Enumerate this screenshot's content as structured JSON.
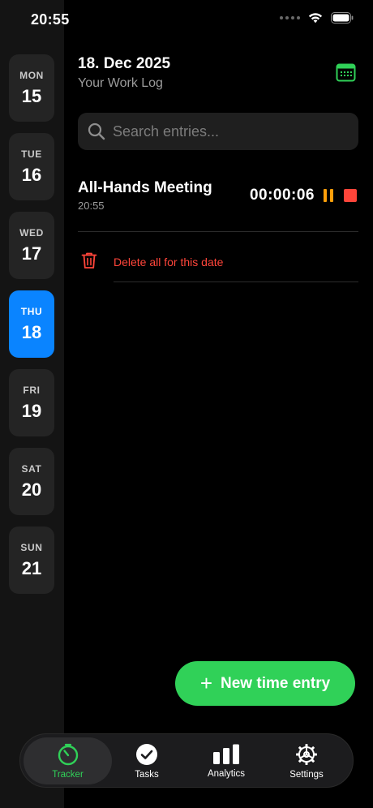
{
  "status_bar": {
    "time": "20:55"
  },
  "days": [
    {
      "dow": "MON",
      "num": "15",
      "active": false
    },
    {
      "dow": "TUE",
      "num": "16",
      "active": false
    },
    {
      "dow": "WED",
      "num": "17",
      "active": false
    },
    {
      "dow": "THU",
      "num": "18",
      "active": true
    },
    {
      "dow": "FRI",
      "num": "19",
      "active": false
    },
    {
      "dow": "SAT",
      "num": "20",
      "active": false
    },
    {
      "dow": "SUN",
      "num": "21",
      "active": false
    }
  ],
  "header": {
    "date": "18. Dec 2025",
    "subtitle": "Your Work Log",
    "calendar_icon": "calendar-icon"
  },
  "search": {
    "placeholder": "Search entries...",
    "value": ""
  },
  "entry": {
    "title": "All-Hands Meeting",
    "start_time": "20:55",
    "duration": "00:00:06"
  },
  "delete_all": {
    "label": "Delete all for this date"
  },
  "new_entry": {
    "label": "New time entry"
  },
  "tabs": [
    {
      "label": "Tracker",
      "icon": "timer-icon",
      "active": true
    },
    {
      "label": "Tasks",
      "icon": "checkmark-icon",
      "active": false
    },
    {
      "label": "Analytics",
      "icon": "bar-chart-icon",
      "active": false
    },
    {
      "label": "Settings",
      "icon": "gear-icon",
      "active": false
    }
  ],
  "colors": {
    "accent_blue": "#0a84ff",
    "accent_green": "#30d158",
    "danger_red": "#ff453a",
    "pause_orange": "#ff9f0a"
  }
}
